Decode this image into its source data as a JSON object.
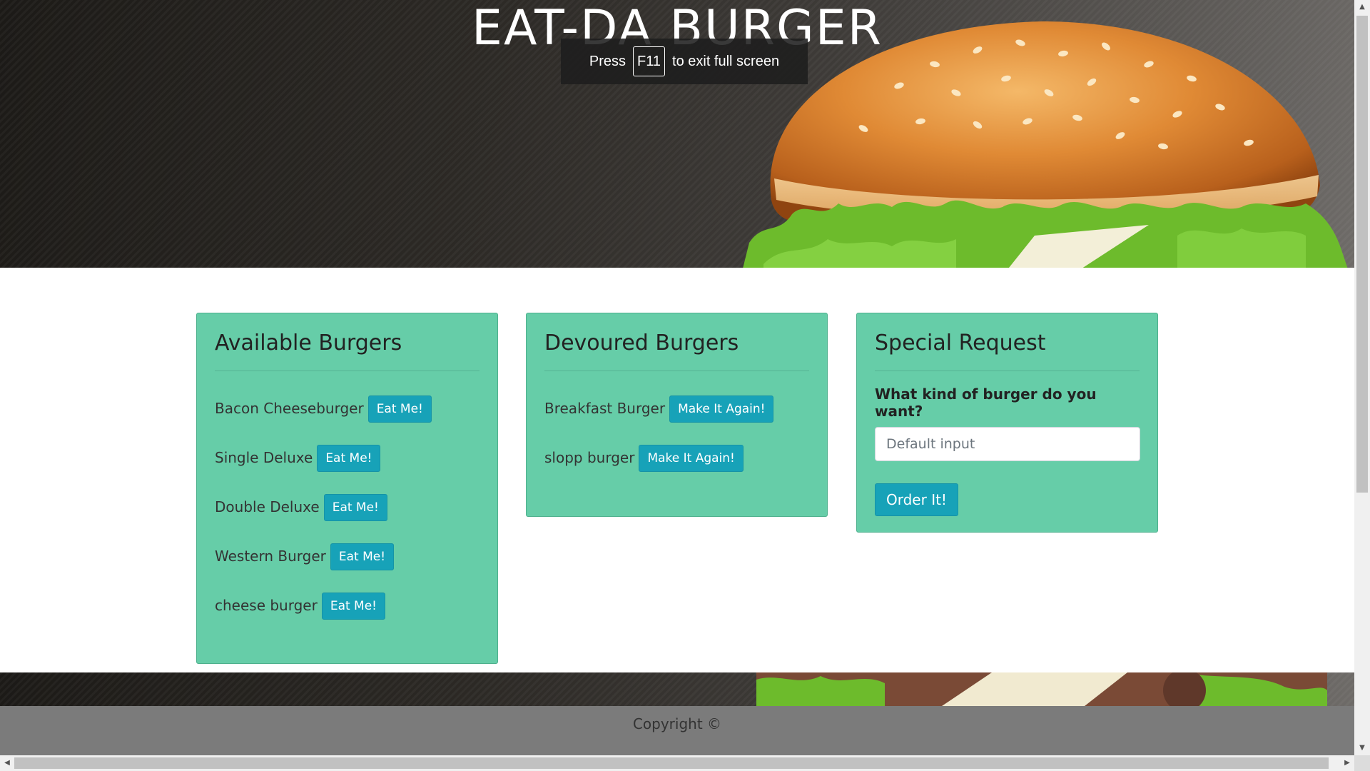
{
  "header": {
    "title": "EAT-DA BURGER"
  },
  "fullscreen_notice": {
    "prefix": "Press",
    "key": "F11",
    "suffix": "to exit full screen"
  },
  "available": {
    "title": "Available Burgers",
    "button_label": "Eat Me!",
    "items": [
      "Bacon Cheeseburger",
      "Single Deluxe",
      "Double Deluxe",
      "Western Burger",
      "cheese burger"
    ]
  },
  "devoured": {
    "title": "Devoured Burgers",
    "button_label": "Make It Again!",
    "items": [
      "Breakfast Burger",
      "slopp burger"
    ]
  },
  "special_request": {
    "title": "Special Request",
    "label": "What kind of burger do you want?",
    "placeholder": "Default input",
    "button_label": "Order It!"
  },
  "footer": {
    "text": "Copyright ©"
  },
  "colors": {
    "card_bg": "#66cda8",
    "button_bg": "#17a2b8",
    "footer_bg": "#7b7b7b"
  }
}
